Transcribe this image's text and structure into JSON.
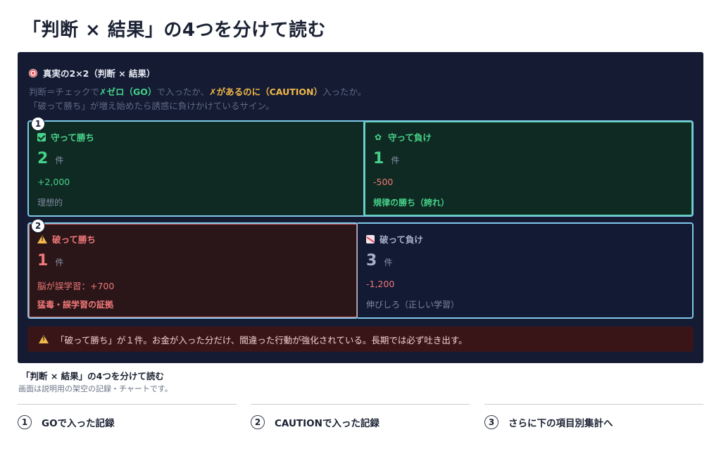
{
  "page_title": "「判断 × 結果」の4つを分けて読む",
  "panel": {
    "heading": "真実の2×2（判断 × 結果）",
    "desc_line1": {
      "pre": "判断＝チェックで",
      "go": "✗ゼロ（GO）",
      "mid": "で入ったか、",
      "caution": "✗があるのに（CAUTION）",
      "post": "入ったか。"
    },
    "desc_line2": "「破って勝ち」が増え始めたら誘惑に負けかけているサイン。",
    "cells": {
      "keep_win": {
        "badge": "1",
        "title": "守って勝ち",
        "count": "2",
        "unit": "件",
        "amount": "+2,000",
        "note": "理想的"
      },
      "keep_lose": {
        "title": "守って負け",
        "count": "1",
        "unit": "件",
        "amount": "-500",
        "note": "規律の勝ち（誇れ）"
      },
      "break_win": {
        "badge": "2",
        "title": "破って勝ち",
        "count": "1",
        "unit": "件",
        "amount": "脳が誤学習：+700",
        "note": "猛毒・誤学習の証拠"
      },
      "break_lose": {
        "title": "破って負け",
        "count": "3",
        "unit": "件",
        "amount": "-1,200",
        "note": "伸びしろ（正しい学習）"
      }
    },
    "alert": "「破って勝ち」が１件。お金が入った分だけ、間違った行動が強化されている。長期では必ず吐き出す。"
  },
  "caption": {
    "title": "「判断 × 結果」の4つを分けて読む",
    "subtitle": "画面は説明用の架空の記録・チャートです。"
  },
  "steps": [
    {
      "num": "1",
      "label": "GOで入った記録"
    },
    {
      "num": "2",
      "label": "CAUTIONで入った記録"
    },
    {
      "num": "3",
      "label": "さらに下の項目別集計へ"
    }
  ],
  "colors": {
    "panel_bg": "#141b33",
    "win_bg": "#0f2a22",
    "loss_bg": "#2a1518",
    "accent_green": "#46d28a",
    "accent_red": "#f07878",
    "accent_yellow": "#f2b84b",
    "cell_border": "#7ec8e8"
  },
  "icons": {
    "heading": "target-icon",
    "keep_win": "check-icon",
    "keep_lose": "sprout-icon",
    "break_win": "warning-icon",
    "break_lose": "chart-down-icon",
    "alert": "warning-icon"
  }
}
